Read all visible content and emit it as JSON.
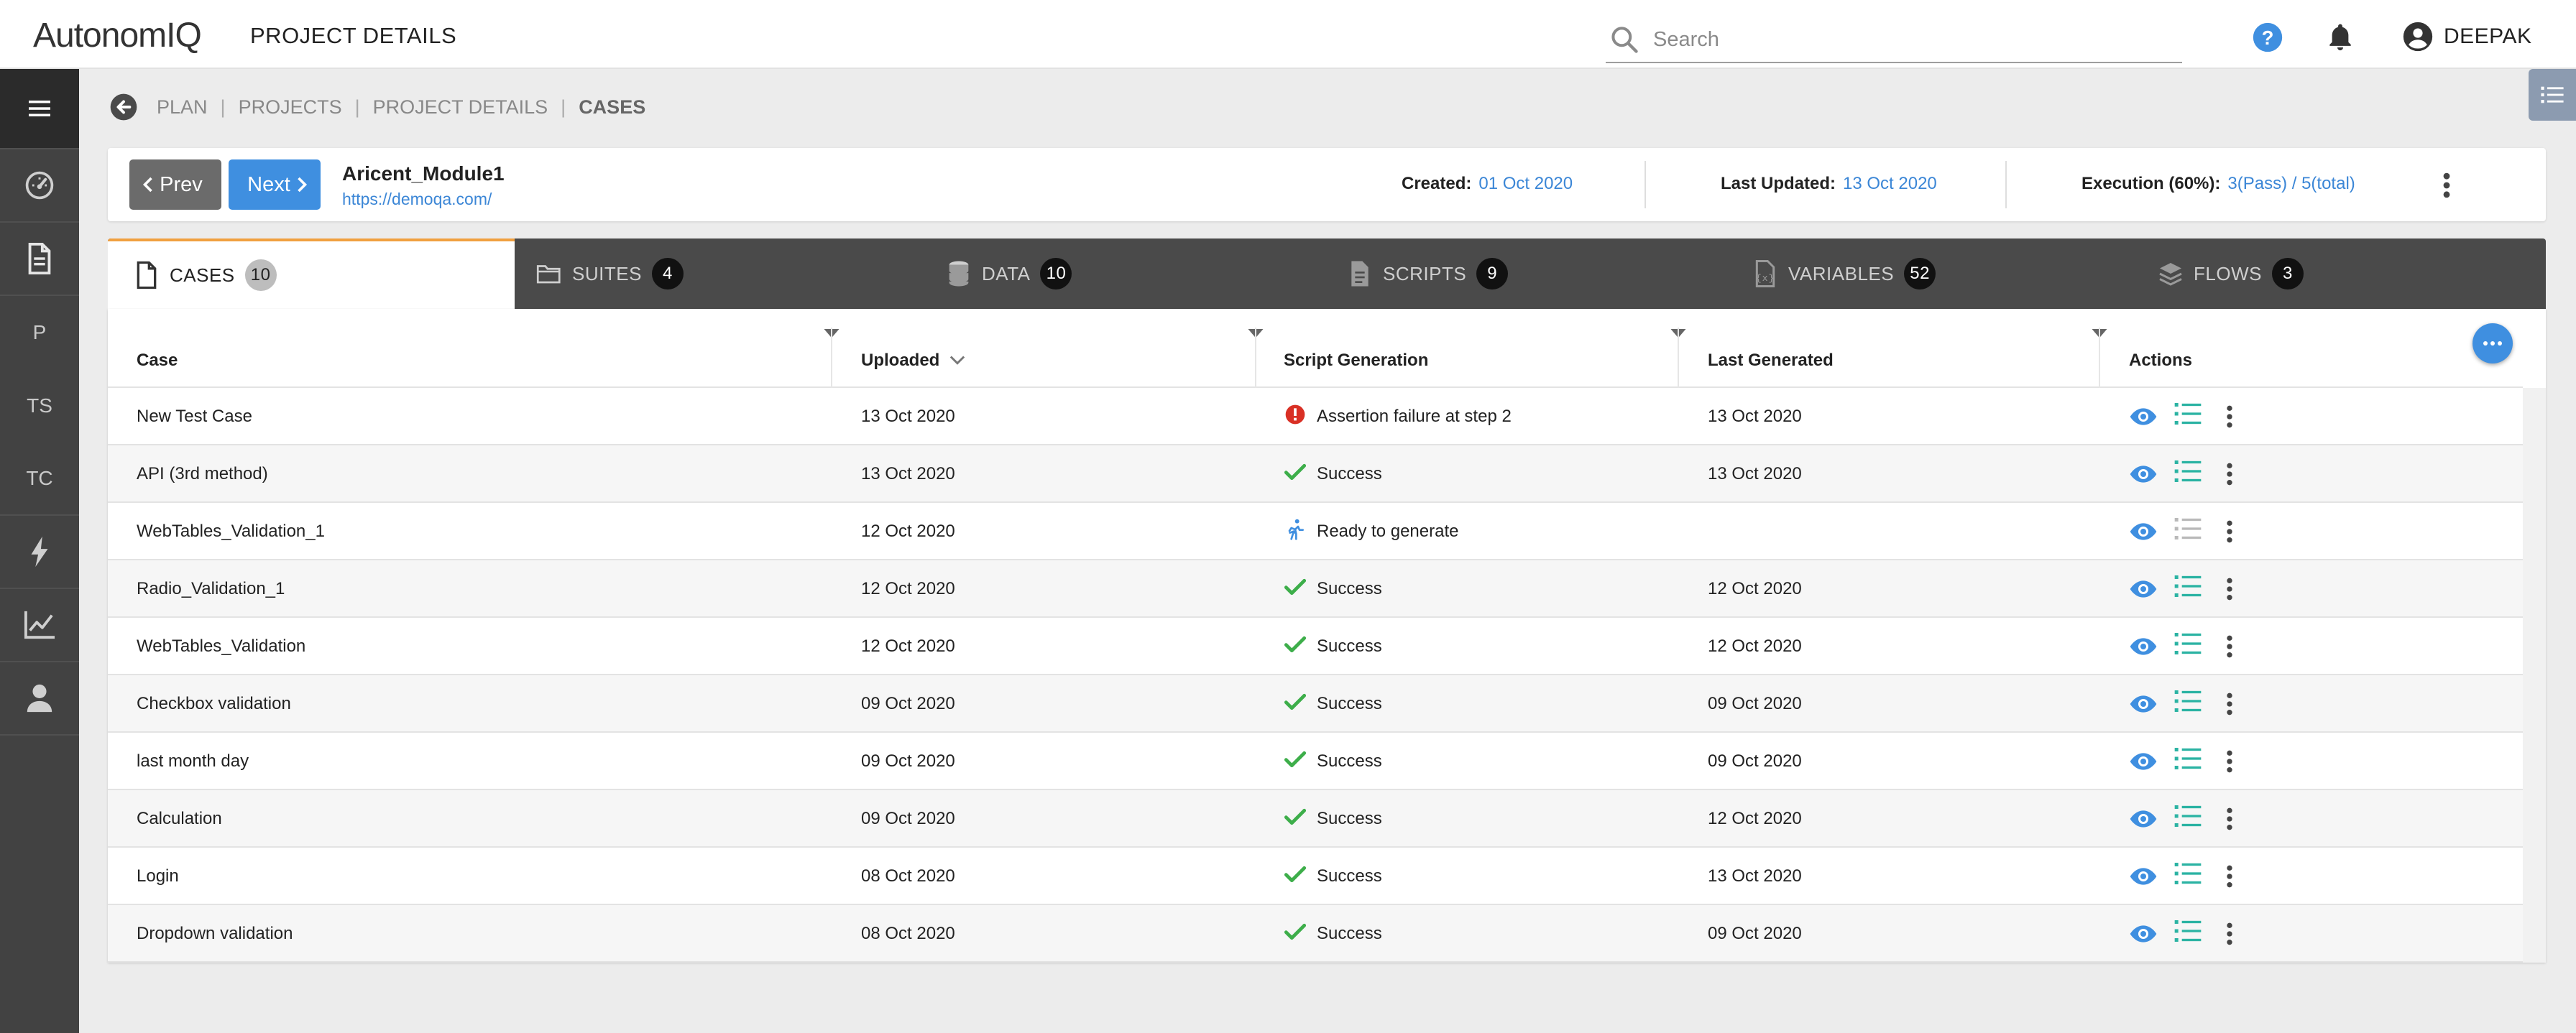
{
  "header": {
    "logo": "AutonomIQ",
    "title": "PROJECT DETAILS",
    "search_placeholder": "Search",
    "user_name": "DEEPAK"
  },
  "sidebar": {
    "items": [
      {
        "name": "menu-icon"
      },
      {
        "name": "dashboard-icon"
      },
      {
        "name": "document-icon"
      },
      {
        "label": "P"
      },
      {
        "label": "TS"
      },
      {
        "label": "TC"
      },
      {
        "name": "lightning-icon"
      },
      {
        "name": "chart-icon"
      },
      {
        "name": "user-icon"
      }
    ]
  },
  "breadcrumb": {
    "items": [
      "PLAN",
      "PROJECTS",
      "PROJECT DETAILS"
    ],
    "current": "CASES",
    "separator": "|"
  },
  "project": {
    "prev_label": "Prev",
    "next_label": "Next",
    "name": "Aricent_Module1",
    "url": "https://demoqa.com/",
    "created_label": "Created:",
    "created_value": "01 Oct 2020",
    "updated_label": "Last Updated:",
    "updated_value": "13 Oct 2020",
    "execution_label": "Execution (60%):",
    "execution_value": "3(Pass) / 5(total)"
  },
  "tabs": [
    {
      "label": "CASES",
      "count": "10",
      "active": true,
      "icon": "file-icon"
    },
    {
      "label": "SUITES",
      "count": "4",
      "icon": "folder-icon"
    },
    {
      "label": "DATA",
      "count": "10",
      "icon": "database-icon"
    },
    {
      "label": "SCRIPTS",
      "count": "9",
      "icon": "script-icon"
    },
    {
      "label": "VARIABLES",
      "count": "52",
      "icon": "variable-file-icon"
    },
    {
      "label": "FLOWS",
      "count": "3",
      "icon": "layers-icon"
    }
  ],
  "table": {
    "columns": [
      "Case",
      "Uploaded",
      "Script Generation",
      "Last Generated",
      "Actions"
    ],
    "rows": [
      {
        "case": "New Test Case",
        "uploaded": "13 Oct 2020",
        "status": "Assertion failure at step 2",
        "status_type": "error",
        "last_generated": "13 Oct 2020"
      },
      {
        "case": "API (3rd method)",
        "uploaded": "13 Oct 2020",
        "status": "Success",
        "status_type": "success",
        "last_generated": "13 Oct 2020"
      },
      {
        "case": "WebTables_Validation_1",
        "uploaded": "12 Oct 2020",
        "status": "Ready to generate",
        "status_type": "ready",
        "last_generated": ""
      },
      {
        "case": "Radio_Validation_1",
        "uploaded": "12 Oct 2020",
        "status": "Success",
        "status_type": "success",
        "last_generated": "12 Oct 2020"
      },
      {
        "case": "WebTables_Validation",
        "uploaded": "12 Oct 2020",
        "status": "Success",
        "status_type": "success",
        "last_generated": "12 Oct 2020"
      },
      {
        "case": "Checkbox validation",
        "uploaded": "09 Oct 2020",
        "status": "Success",
        "status_type": "success",
        "last_generated": "09 Oct 2020"
      },
      {
        "case": "last month day",
        "uploaded": "09 Oct 2020",
        "status": "Success",
        "status_type": "success",
        "last_generated": "09 Oct 2020"
      },
      {
        "case": "Calculation",
        "uploaded": "09 Oct 2020",
        "status": "Success",
        "status_type": "success",
        "last_generated": "12 Oct 2020"
      },
      {
        "case": "Login",
        "uploaded": "08 Oct 2020",
        "status": "Success",
        "status_type": "success",
        "last_generated": "13 Oct 2020"
      },
      {
        "case": "Dropdown validation",
        "uploaded": "08 Oct 2020",
        "status": "Success",
        "status_type": "success",
        "last_generated": "09 Oct 2020"
      }
    ]
  },
  "colors": {
    "accent_blue": "#3f8fe0",
    "success_green": "#3dae4a",
    "error_red": "#d93025",
    "sidebar_dark": "#424242",
    "tab_bar": "#4a4a4a",
    "tab_active_border": "#f0a040"
  }
}
